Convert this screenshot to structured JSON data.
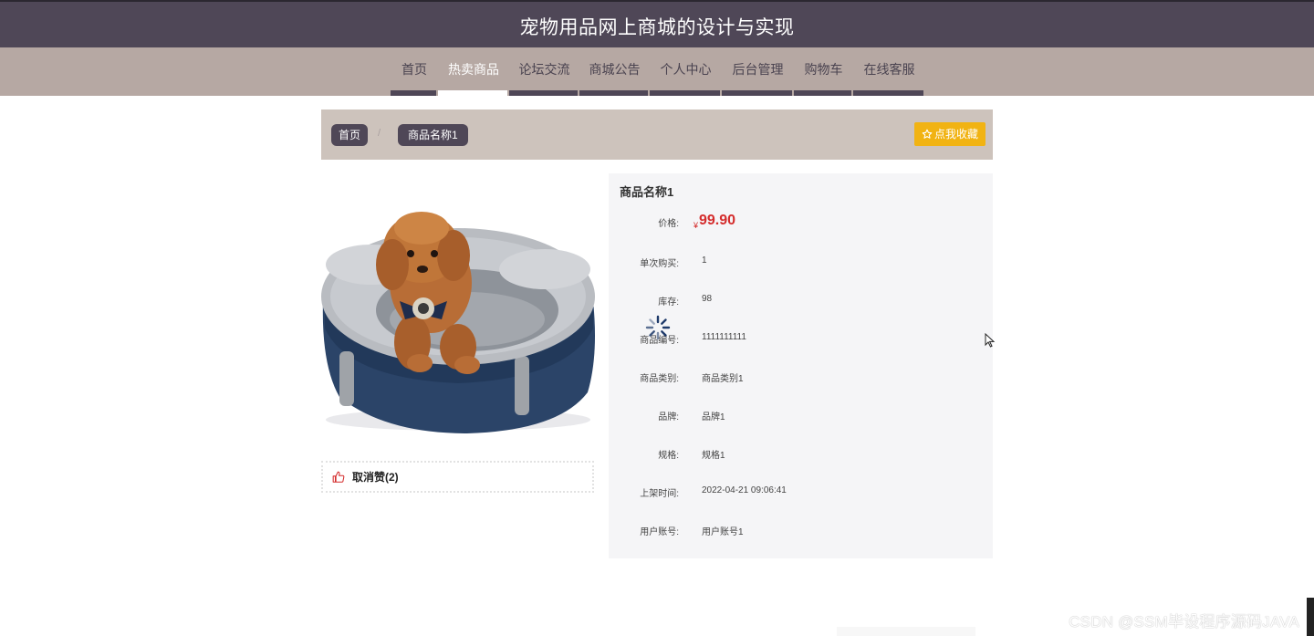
{
  "site": {
    "title": "宠物用品网上商城的设计与实现"
  },
  "nav": {
    "items": [
      {
        "label": "首页"
      },
      {
        "label": "热卖商品"
      },
      {
        "label": "论坛交流"
      },
      {
        "label": "商城公告"
      },
      {
        "label": "个人中心"
      },
      {
        "label": "后台管理"
      },
      {
        "label": "购物车"
      },
      {
        "label": "在线客服"
      }
    ],
    "active_index": 1
  },
  "breadcrumb": {
    "home": "首页",
    "separator": "/",
    "current": "商品名称1"
  },
  "favorite_button": {
    "label": "点我收藏",
    "icon": "star-outline-icon"
  },
  "product": {
    "name": "商品名称1",
    "price_currency": "¥",
    "price": "99.90",
    "price_label": "价格:",
    "image_icon": "dog-bed-photo",
    "like": {
      "label": "取消赞(2)",
      "icon": "thumbs-up-icon"
    },
    "details": [
      {
        "label": "单次购买:",
        "value": "1"
      },
      {
        "label": "库存:",
        "value": "98"
      },
      {
        "label": "商品编号:",
        "value": "1111111111"
      },
      {
        "label": "商品类别:",
        "value": "商品类别1"
      },
      {
        "label": "品牌:",
        "value": "品牌1"
      },
      {
        "label": "规格:",
        "value": "规格1"
      },
      {
        "label": "上架时间:",
        "value": "2022-04-21 09:06:41"
      },
      {
        "label": "用户账号:",
        "value": "用户账号1"
      }
    ]
  },
  "watermark": {
    "text": "CSDN @SSM毕设程序源码JAVA"
  },
  "colors": {
    "header": "#4f4757",
    "nav_bg": "#b6a8a3",
    "crumb_bg": "#cdc3bc",
    "accent_yellow": "#f1b313",
    "price_red": "#d42c2c"
  }
}
